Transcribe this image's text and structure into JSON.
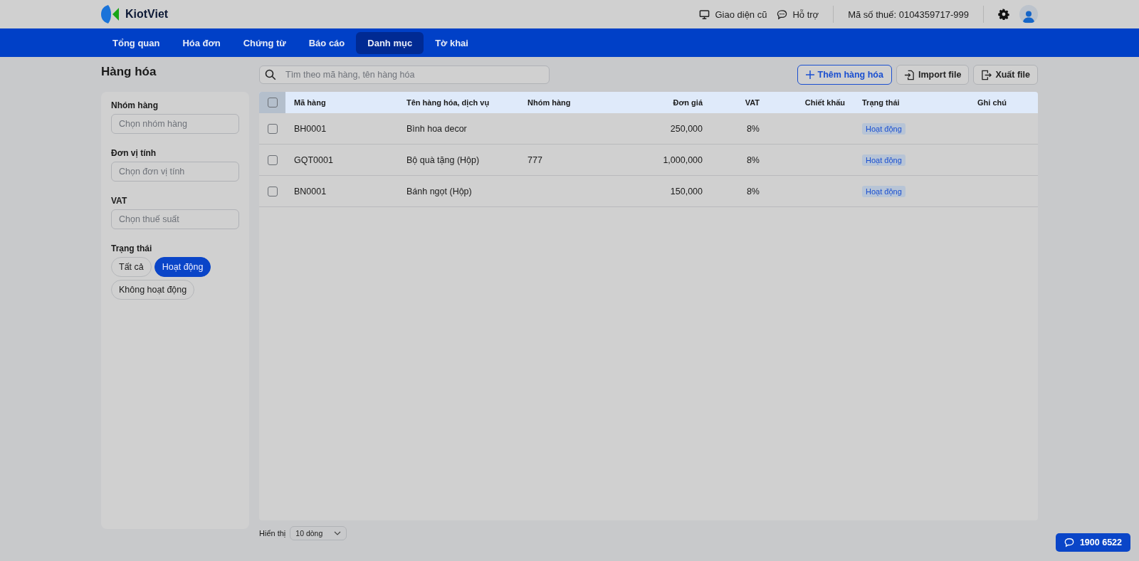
{
  "brand": {
    "name": "KiotViet"
  },
  "topbar": {
    "links": [
      "Giao diện cũ",
      "Hỗ trợ"
    ],
    "tax_id": "Mã số thuế: 0104359717-999"
  },
  "nav": [
    {
      "label": "Tổng quan",
      "selected": false
    },
    {
      "label": "Hóa đơn",
      "selected": false
    },
    {
      "label": "Chứng từ",
      "selected": false
    },
    {
      "label": "Báo cáo",
      "selected": false
    },
    {
      "label": "Danh mục",
      "selected": true
    },
    {
      "label": "Tờ khai",
      "selected": false
    }
  ],
  "page_title": "Hàng hóa",
  "filters": [
    {
      "label": "Nhóm hàng",
      "placeholder": "Chọn nhóm hàng"
    },
    {
      "label": "Đơn vị tính",
      "placeholder": "Chọn đơn vị tính"
    },
    {
      "label": "VAT",
      "placeholder": "Chọn thuế suất"
    }
  ],
  "status_filter": {
    "label": "Trạng thái",
    "options": [
      {
        "label": "Tất cả",
        "selected": false
      },
      {
        "label": "Hoạt động",
        "selected": true
      },
      {
        "label": "Không hoạt động",
        "selected": false
      }
    ]
  },
  "search": {
    "placeholder": "Tìm theo mã hàng, tên hàng hóa"
  },
  "actions": [
    "Thêm hàng hóa",
    "Import file",
    "Xuất file"
  ],
  "table": {
    "select_all_checked": false,
    "columns": [
      "Mã hàng",
      "Tên hàng hóa, dịch vụ",
      "Nhóm hàng",
      "Đơn giá",
      "VAT",
      "Chiết khấu",
      "Trạng thái",
      "Ghi chú"
    ],
    "rows": [
      {
        "checked": false,
        "cells": [
          "BH0001",
          "Bình hoa decor",
          "",
          "250,000",
          "8%",
          "",
          "Hoạt động",
          ""
        ]
      },
      {
        "checked": false,
        "cells": [
          "GQT0001",
          "Bộ quà tặng (Hộp)",
          "777",
          "1,000,000",
          "8%",
          "",
          "Hoạt động",
          ""
        ]
      },
      {
        "checked": false,
        "cells": [
          "BN0001",
          "Bánh ngọt (Hộp)",
          "",
          "150,000",
          "8%",
          "",
          "Hoạt động",
          ""
        ]
      }
    ]
  },
  "pagination": {
    "label": "Hiển thị",
    "page_size": "10 dòng"
  },
  "hotline": "1900 6522"
}
